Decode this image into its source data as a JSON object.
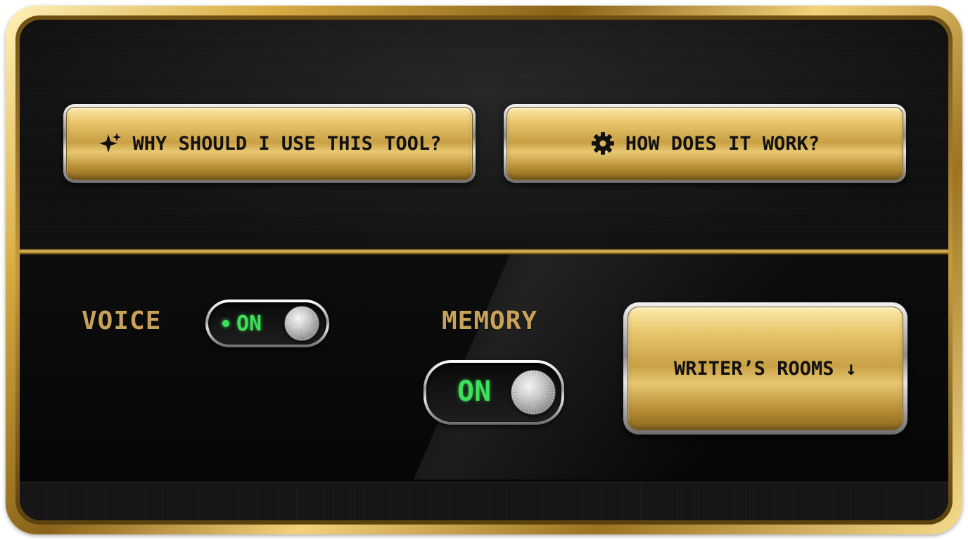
{
  "top_buttons": [
    {
      "label": "WHY SHOULD I USE THIS TOOL?",
      "icon": "sparkle-icon"
    },
    {
      "label": "HOW DOES IT WORK?",
      "icon": "gear-icon"
    }
  ],
  "voice": {
    "label": "VOICE",
    "toggle_state": "ON",
    "indicator": "green-dot"
  },
  "memory": {
    "label": "MEMORY",
    "toggle_state": "ON"
  },
  "writers_rooms": {
    "label": "WRITER’S ROOMS ↓"
  },
  "colors": {
    "gold": "#d4ad52",
    "label_gold": "#c9a25a",
    "toggle_green": "#3ee05a",
    "panel_black": "#0c0c0c"
  }
}
